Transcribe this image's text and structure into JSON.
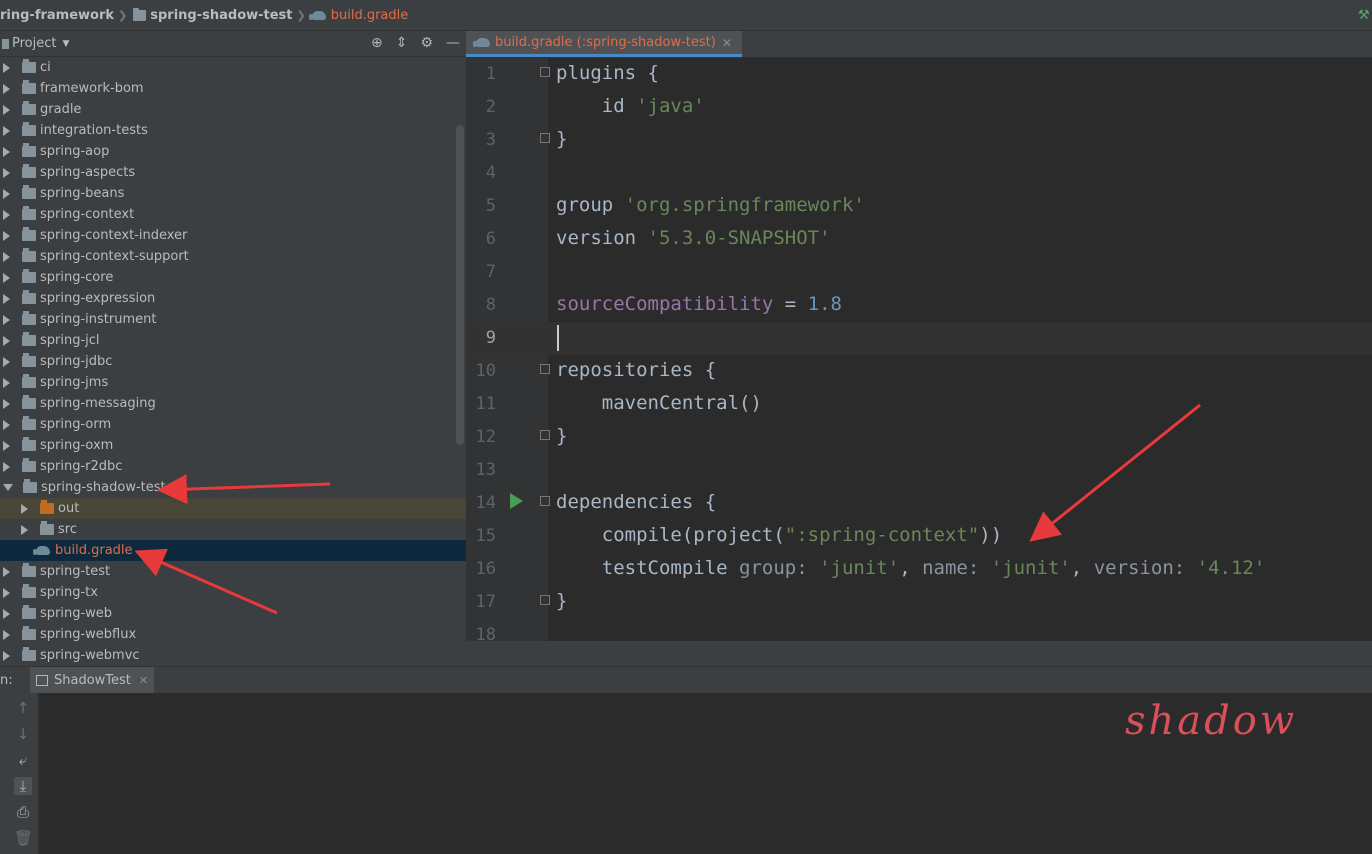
{
  "breadcrumb": {
    "root": "ring-framework",
    "module": "spring-shadow-test",
    "file": "build.gradle"
  },
  "project_panel": {
    "title": "Project",
    "tree": [
      {
        "label": "ci",
        "type": "folder",
        "expanded": false
      },
      {
        "label": "framework-bom",
        "type": "folder",
        "expanded": false
      },
      {
        "label": "gradle",
        "type": "folder",
        "expanded": false
      },
      {
        "label": "integration-tests",
        "type": "folder",
        "expanded": false
      },
      {
        "label": "spring-aop",
        "type": "folder",
        "expanded": false
      },
      {
        "label": "spring-aspects",
        "type": "folder",
        "expanded": false
      },
      {
        "label": "spring-beans",
        "type": "folder",
        "expanded": false
      },
      {
        "label": "spring-context",
        "type": "folder",
        "expanded": false
      },
      {
        "label": "spring-context-indexer",
        "type": "folder",
        "expanded": false
      },
      {
        "label": "spring-context-support",
        "type": "folder",
        "expanded": false
      },
      {
        "label": "spring-core",
        "type": "folder",
        "expanded": false
      },
      {
        "label": "spring-expression",
        "type": "folder",
        "expanded": false
      },
      {
        "label": "spring-instrument",
        "type": "folder",
        "expanded": false
      },
      {
        "label": "spring-jcl",
        "type": "folder",
        "expanded": false
      },
      {
        "label": "spring-jdbc",
        "type": "folder",
        "expanded": false
      },
      {
        "label": "spring-jms",
        "type": "folder",
        "expanded": false
      },
      {
        "label": "spring-messaging",
        "type": "folder",
        "expanded": false
      },
      {
        "label": "spring-orm",
        "type": "folder",
        "expanded": false
      },
      {
        "label": "spring-oxm",
        "type": "folder",
        "expanded": false
      },
      {
        "label": "spring-r2dbc",
        "type": "folder",
        "expanded": false
      },
      {
        "label": "spring-shadow-test",
        "type": "folder",
        "expanded": true
      },
      {
        "label": "out",
        "type": "folder-orange",
        "expanded": false,
        "child": true
      },
      {
        "label": "src",
        "type": "folder",
        "expanded": false,
        "child": true
      },
      {
        "label": "build.gradle",
        "type": "gradle",
        "child": true
      },
      {
        "label": "spring-test",
        "type": "folder",
        "expanded": false
      },
      {
        "label": "spring-tx",
        "type": "folder",
        "expanded": false
      },
      {
        "label": "spring-web",
        "type": "folder",
        "expanded": false
      },
      {
        "label": "spring-webflux",
        "type": "folder",
        "expanded": false
      },
      {
        "label": "spring-webmvc",
        "type": "folder",
        "expanded": false
      }
    ]
  },
  "editor": {
    "tab_label": "build.gradle (:spring-shadow-test)",
    "current_line": 9,
    "line_numbers": [
      "1",
      "2",
      "3",
      "4",
      "5",
      "6",
      "7",
      "8",
      "9",
      "10",
      "11",
      "12",
      "13",
      "14",
      "15",
      "16",
      "17",
      "18"
    ],
    "code": {
      "l1": "plugins {",
      "l2_a": "    id ",
      "l2_b": "'java'",
      "l3": "}",
      "l5_a": "group ",
      "l5_b": "'org.springframework'",
      "l6_a": "version ",
      "l6_b": "'5.3.0-SNAPSHOT'",
      "l8_a": "sourceCompatibility",
      "l8_b": " = ",
      "l8_c": "1.8",
      "l10": "repositories {",
      "l11": "    mavenCentral()",
      "l12": "}",
      "l14": "dependencies {",
      "l15_a": "    compile(project(",
      "l15_b": "\":spring-context\"",
      "l15_c": "))",
      "l16_a": "    testCompile ",
      "l16_b": "group: ",
      "l16_c": "'junit'",
      "l16_d": ", ",
      "l16_e": "name: ",
      "l16_f": "'junit'",
      "l16_g": ", ",
      "l16_h": "version: ",
      "l16_i": "'4.12'",
      "l17": "}"
    }
  },
  "run_panel": {
    "label": "n:",
    "tab_label": "ShadowTest"
  },
  "watermark": "shadow",
  "colors": {
    "string": "#6a8759",
    "property": "#9876aa",
    "number": "#6897bb",
    "file_modified": "#e06c4a",
    "arrow": "#e83a3a"
  }
}
